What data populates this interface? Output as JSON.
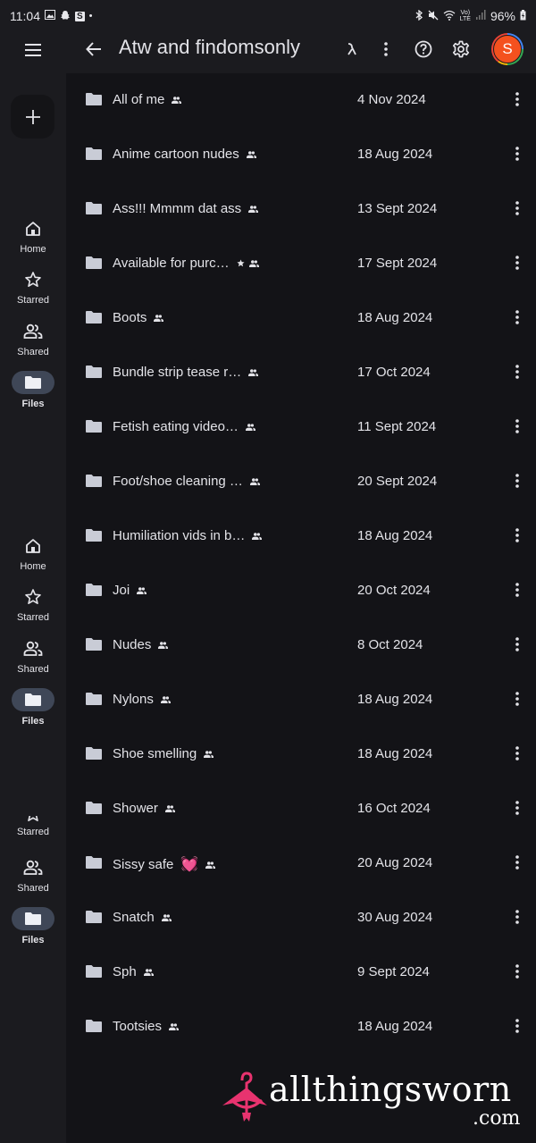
{
  "status_bar": {
    "time": "11:04",
    "left_icons": [
      "gallery-icon",
      "snapchat-icon",
      "s-app-icon",
      "dot-icon"
    ],
    "right_icons": [
      "bluetooth-icon",
      "mute-icon",
      "wifi-icon",
      "volte-icon",
      "signal-icon"
    ],
    "battery": "96%"
  },
  "header": {
    "title": "Atw and findomsonly",
    "avatar_letter": "S",
    "icons": [
      "menu-icon",
      "back-icon",
      "activity-icon",
      "more-vert-icon",
      "help-icon",
      "settings-icon"
    ]
  },
  "fab": {
    "label": "+"
  },
  "nav_groups": [
    {
      "items": [
        {
          "label": "Home",
          "icon": "home-icon"
        },
        {
          "label": "Starred",
          "icon": "star-icon"
        },
        {
          "label": "Shared",
          "icon": "shared-icon"
        },
        {
          "label": "Files",
          "icon": "folder-icon",
          "active": true
        }
      ]
    },
    {
      "items": [
        {
          "label": "Home",
          "icon": "home-icon"
        },
        {
          "label": "Starred",
          "icon": "star-icon"
        },
        {
          "label": "Shared",
          "icon": "shared-icon"
        },
        {
          "label": "Files",
          "icon": "folder-icon",
          "active": true
        }
      ]
    },
    {
      "items": [
        {
          "label": "Starred",
          "icon": "star-icon"
        },
        {
          "label": "Shared",
          "icon": "shared-icon"
        },
        {
          "label": "Files",
          "icon": "folder-icon",
          "active": true
        }
      ]
    }
  ],
  "files": [
    {
      "name": "All of me",
      "date": "4 Nov 2024",
      "starred": false,
      "shared": true
    },
    {
      "name": "Anime cartoon nudes",
      "date": "18 Aug 2024",
      "starred": false,
      "shared": true
    },
    {
      "name": "Ass!!! Mmmm dat ass",
      "date": "13 Sept 2024",
      "starred": false,
      "shared": true
    },
    {
      "name": "Available for purc…",
      "date": "17 Sept 2024",
      "starred": true,
      "shared": true
    },
    {
      "name": "Boots",
      "date": "18 Aug 2024",
      "starred": false,
      "shared": true
    },
    {
      "name": "Bundle strip tease r…",
      "date": "17 Oct 2024",
      "starred": false,
      "shared": true
    },
    {
      "name": "Fetish eating video…",
      "date": "11 Sept 2024",
      "starred": false,
      "shared": true
    },
    {
      "name": "Foot/shoe cleaning …",
      "date": "20 Sept 2024",
      "starred": false,
      "shared": true
    },
    {
      "name": "Humiliation vids in b…",
      "date": "18 Aug 2024",
      "starred": false,
      "shared": true
    },
    {
      "name": "Joi",
      "date": "20 Oct 2024",
      "starred": false,
      "shared": true
    },
    {
      "name": "Nudes",
      "date": "8 Oct 2024",
      "starred": false,
      "shared": true
    },
    {
      "name": "Nylons",
      "date": "18 Aug 2024",
      "starred": false,
      "shared": true
    },
    {
      "name": "Shoe smelling",
      "date": "18 Aug 2024",
      "starred": false,
      "shared": true
    },
    {
      "name": "Shower",
      "date": "16 Oct 2024",
      "starred": false,
      "shared": true
    },
    {
      "name": "Sissy safe",
      "emoji": "💓",
      "date": "20 Aug 2024",
      "starred": false,
      "shared": true
    },
    {
      "name": "Snatch",
      "date": "30 Aug 2024",
      "starred": false,
      "shared": true
    },
    {
      "name": "Sph",
      "date": "9 Sept 2024",
      "starred": false,
      "shared": true
    },
    {
      "name": "Tootsies",
      "date": "18 Aug 2024",
      "starred": false,
      "shared": true
    }
  ],
  "watermark": {
    "text": "allthingsworn",
    "suffix": ".com",
    "accent": "#e8336f"
  },
  "colors": {
    "background": "#131317",
    "rail": "#1b1b1f",
    "active_pill": "#3f4757",
    "avatar": "#f4511e"
  }
}
